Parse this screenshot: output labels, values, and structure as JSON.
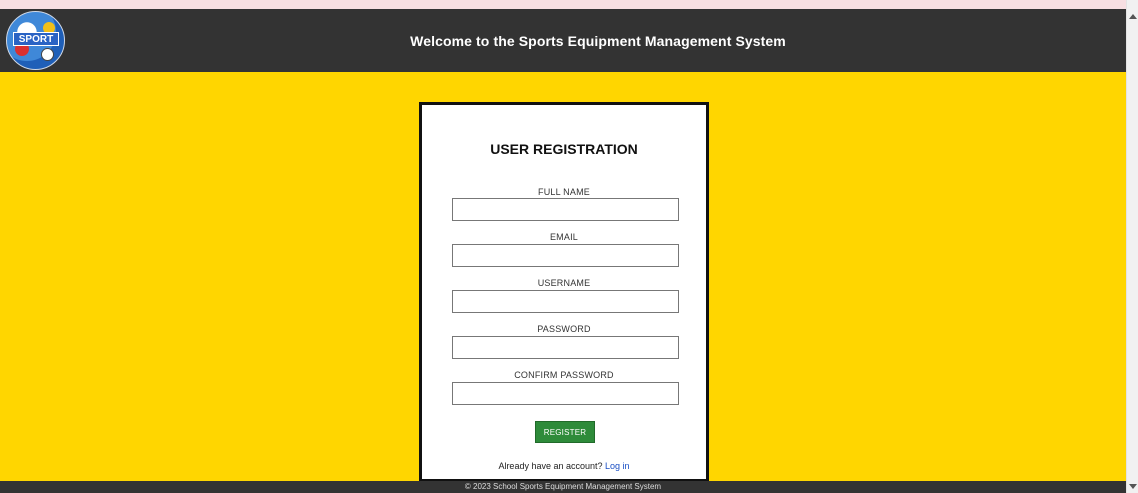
{
  "header": {
    "title": "Welcome to the Sports Equipment Management System",
    "logo_text": "SPORT"
  },
  "form": {
    "title": "USER REGISTRATION",
    "fields": [
      {
        "label": "FULL NAME",
        "value": "",
        "placeholder": ""
      },
      {
        "label": "EMAIL",
        "value": "",
        "placeholder": ""
      },
      {
        "label": "USERNAME",
        "value": "",
        "placeholder": ""
      },
      {
        "label": "PASSWORD",
        "value": "",
        "placeholder": ""
      },
      {
        "label": "CONFIRM PASSWORD",
        "value": "",
        "placeholder": ""
      }
    ],
    "register_label": "REGISTER",
    "login_prompt": "Already have an account?",
    "login_link": "Log in"
  },
  "footer": {
    "text": "© 2023 School Sports Equipment Management System"
  },
  "colors": {
    "page_background": "#ffd600",
    "header_background": "#333333",
    "register_button": "#2e8b3a",
    "link": "#1a4fc4"
  },
  "icons": {
    "logo": "sport-logo-icon",
    "scroll_up": "scroll-up-arrow-icon",
    "scroll_down": "scroll-down-arrow-icon"
  }
}
